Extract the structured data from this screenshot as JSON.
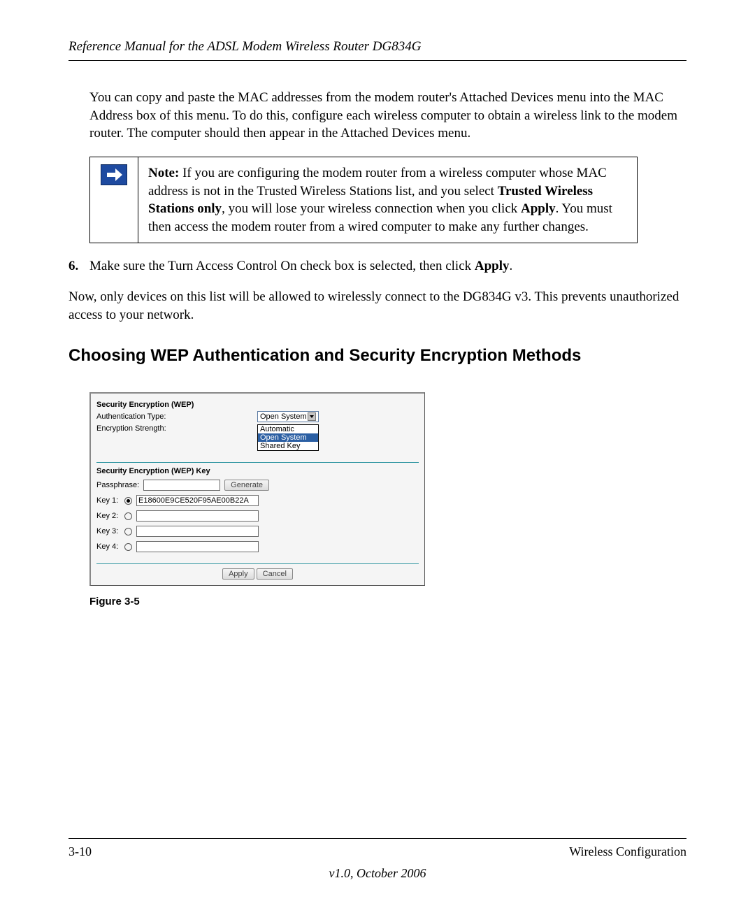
{
  "header": {
    "title": "Reference Manual for the ADSL Modem Wireless Router DG834G"
  },
  "paragraphs": {
    "intro": "You can copy and paste the MAC addresses from the modem router's Attached Devices menu into the MAC Address box of this menu. To do this, configure each wireless computer to obtain a wireless link to the modem router. The computer should then appear in the Attached Devices menu."
  },
  "note": {
    "label": "Note:",
    "part1": " If you are configuring the modem router from a wireless computer whose MAC address is not in the Trusted Wireless Stations list, and you select ",
    "bold1": "Trusted Wireless Stations only",
    "part2": ", you will lose your wireless connection when you click ",
    "bold2": "Apply",
    "part3": ". You must then access the modem router from a wired computer to make any further changes."
  },
  "list": {
    "num": "6.",
    "text_a": "Make sure the Turn Access Control On check box is selected, then click ",
    "text_bold": "Apply",
    "text_b": "."
  },
  "body2": "Now, only devices on this list will be allowed to wirelessly connect to the DG834G v3. This prevents unauthorized access to your network.",
  "heading": "Choosing WEP Authentication and Security Encryption Methods",
  "wep": {
    "section1": "Security Encryption (WEP)",
    "auth_label": "Authentication Type:",
    "auth_value": "Open System",
    "enc_label": "Encryption Strength:",
    "dropdown": {
      "opt1": "Automatic",
      "opt2": "Open System",
      "opt3": "Shared Key"
    },
    "section2": "Security Encryption (WEP) Key",
    "pass_label": "Passphrase:",
    "generate": "Generate",
    "key1_label": "Key 1:",
    "key1_value": "E18600E9CE520F95AE00B22A",
    "key2_label": "Key 2:",
    "key3_label": "Key 3:",
    "key4_label": "Key 4:",
    "apply": "Apply",
    "cancel": "Cancel"
  },
  "figure_caption": "Figure 3-5",
  "footer": {
    "page": "3-10",
    "section": "Wireless Configuration",
    "version": "v1.0, October 2006"
  }
}
